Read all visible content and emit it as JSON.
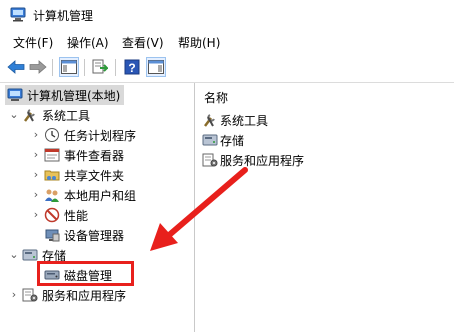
{
  "window": {
    "title": "计算机管理"
  },
  "menu": [
    "文件(F)",
    "操作(A)",
    "查看(V)",
    "帮助(H)"
  ],
  "tree": {
    "root": "计算机管理(本地)",
    "system_tools": "系统工具",
    "children": [
      "任务计划程序",
      "事件查看器",
      "共享文件夹",
      "本地用户和组",
      "性能",
      "设备管理器"
    ],
    "storage": "存储",
    "disk_management": "磁盘管理",
    "services": "服务和应用程序"
  },
  "right_pane": {
    "column_header": "名称",
    "items": [
      "系统工具",
      "存储",
      "服务和应用程序"
    ]
  },
  "colors": {
    "highlight": "#e8201c",
    "selected_row": "#d9d9d9"
  }
}
